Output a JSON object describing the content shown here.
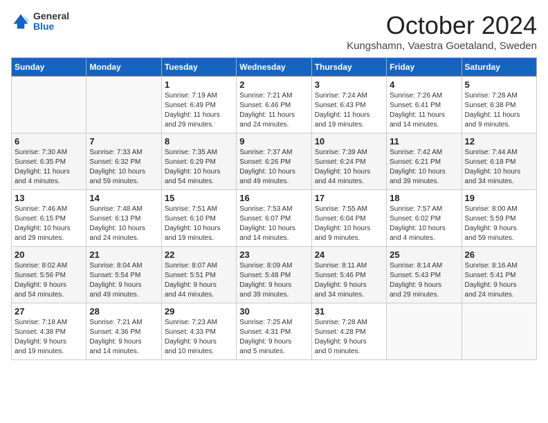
{
  "logo": {
    "general": "General",
    "blue": "Blue"
  },
  "header": {
    "month": "October 2024",
    "location": "Kungshamn, Vaestra Goetaland, Sweden"
  },
  "weekdays": [
    "Sunday",
    "Monday",
    "Tuesday",
    "Wednesday",
    "Thursday",
    "Friday",
    "Saturday"
  ],
  "weeks": [
    [
      {
        "day": "",
        "info": ""
      },
      {
        "day": "",
        "info": ""
      },
      {
        "day": "1",
        "info": "Sunrise: 7:19 AM\nSunset: 6:49 PM\nDaylight: 11 hours\nand 29 minutes."
      },
      {
        "day": "2",
        "info": "Sunrise: 7:21 AM\nSunset: 6:46 PM\nDaylight: 11 hours\nand 24 minutes."
      },
      {
        "day": "3",
        "info": "Sunrise: 7:24 AM\nSunset: 6:43 PM\nDaylight: 11 hours\nand 19 minutes."
      },
      {
        "day": "4",
        "info": "Sunrise: 7:26 AM\nSunset: 6:41 PM\nDaylight: 11 hours\nand 14 minutes."
      },
      {
        "day": "5",
        "info": "Sunrise: 7:28 AM\nSunset: 6:38 PM\nDaylight: 11 hours\nand 9 minutes."
      }
    ],
    [
      {
        "day": "6",
        "info": "Sunrise: 7:30 AM\nSunset: 6:35 PM\nDaylight: 11 hours\nand 4 minutes."
      },
      {
        "day": "7",
        "info": "Sunrise: 7:33 AM\nSunset: 6:32 PM\nDaylight: 10 hours\nand 59 minutes."
      },
      {
        "day": "8",
        "info": "Sunrise: 7:35 AM\nSunset: 6:29 PM\nDaylight: 10 hours\nand 54 minutes."
      },
      {
        "day": "9",
        "info": "Sunrise: 7:37 AM\nSunset: 6:26 PM\nDaylight: 10 hours\nand 49 minutes."
      },
      {
        "day": "10",
        "info": "Sunrise: 7:39 AM\nSunset: 6:24 PM\nDaylight: 10 hours\nand 44 minutes."
      },
      {
        "day": "11",
        "info": "Sunrise: 7:42 AM\nSunset: 6:21 PM\nDaylight: 10 hours\nand 39 minutes."
      },
      {
        "day": "12",
        "info": "Sunrise: 7:44 AM\nSunset: 6:18 PM\nDaylight: 10 hours\nand 34 minutes."
      }
    ],
    [
      {
        "day": "13",
        "info": "Sunrise: 7:46 AM\nSunset: 6:15 PM\nDaylight: 10 hours\nand 29 minutes."
      },
      {
        "day": "14",
        "info": "Sunrise: 7:48 AM\nSunset: 6:13 PM\nDaylight: 10 hours\nand 24 minutes."
      },
      {
        "day": "15",
        "info": "Sunrise: 7:51 AM\nSunset: 6:10 PM\nDaylight: 10 hours\nand 19 minutes."
      },
      {
        "day": "16",
        "info": "Sunrise: 7:53 AM\nSunset: 6:07 PM\nDaylight: 10 hours\nand 14 minutes."
      },
      {
        "day": "17",
        "info": "Sunrise: 7:55 AM\nSunset: 6:04 PM\nDaylight: 10 hours\nand 9 minutes."
      },
      {
        "day": "18",
        "info": "Sunrise: 7:57 AM\nSunset: 6:02 PM\nDaylight: 10 hours\nand 4 minutes."
      },
      {
        "day": "19",
        "info": "Sunrise: 8:00 AM\nSunset: 5:59 PM\nDaylight: 9 hours\nand 59 minutes."
      }
    ],
    [
      {
        "day": "20",
        "info": "Sunrise: 8:02 AM\nSunset: 5:56 PM\nDaylight: 9 hours\nand 54 minutes."
      },
      {
        "day": "21",
        "info": "Sunrise: 8:04 AM\nSunset: 5:54 PM\nDaylight: 9 hours\nand 49 minutes."
      },
      {
        "day": "22",
        "info": "Sunrise: 8:07 AM\nSunset: 5:51 PM\nDaylight: 9 hours\nand 44 minutes."
      },
      {
        "day": "23",
        "info": "Sunrise: 8:09 AM\nSunset: 5:48 PM\nDaylight: 9 hours\nand 39 minutes."
      },
      {
        "day": "24",
        "info": "Sunrise: 8:11 AM\nSunset: 5:46 PM\nDaylight: 9 hours\nand 34 minutes."
      },
      {
        "day": "25",
        "info": "Sunrise: 8:14 AM\nSunset: 5:43 PM\nDaylight: 9 hours\nand 29 minutes."
      },
      {
        "day": "26",
        "info": "Sunrise: 8:16 AM\nSunset: 5:41 PM\nDaylight: 9 hours\nand 24 minutes."
      }
    ],
    [
      {
        "day": "27",
        "info": "Sunrise: 7:18 AM\nSunset: 4:38 PM\nDaylight: 9 hours\nand 19 minutes."
      },
      {
        "day": "28",
        "info": "Sunrise: 7:21 AM\nSunset: 4:36 PM\nDaylight: 9 hours\nand 14 minutes."
      },
      {
        "day": "29",
        "info": "Sunrise: 7:23 AM\nSunset: 4:33 PM\nDaylight: 9 hours\nand 10 minutes."
      },
      {
        "day": "30",
        "info": "Sunrise: 7:25 AM\nSunset: 4:31 PM\nDaylight: 9 hours\nand 5 minutes."
      },
      {
        "day": "31",
        "info": "Sunrise: 7:28 AM\nSunset: 4:28 PM\nDaylight: 9 hours\nand 0 minutes."
      },
      {
        "day": "",
        "info": ""
      },
      {
        "day": "",
        "info": ""
      }
    ]
  ]
}
